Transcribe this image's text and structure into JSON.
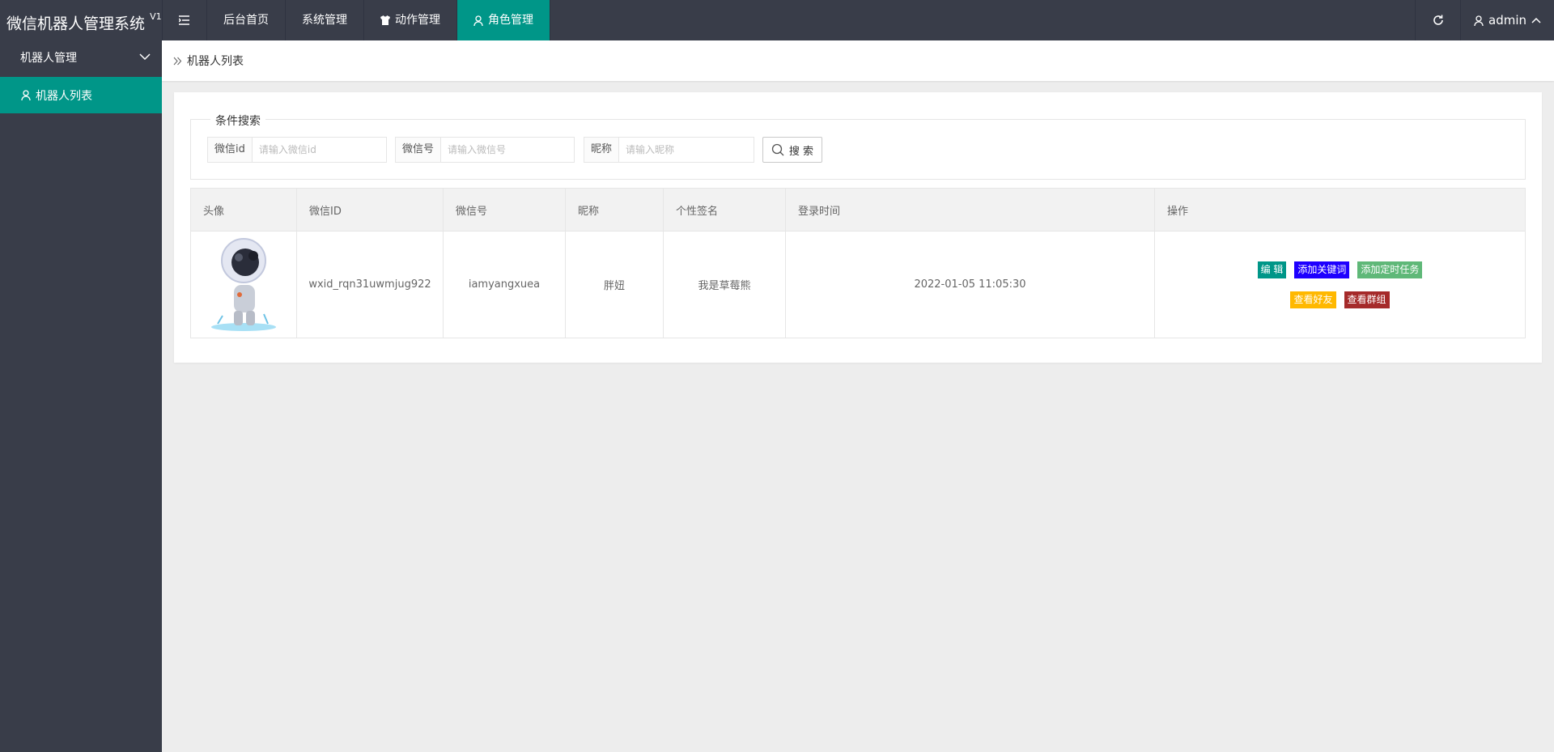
{
  "app": {
    "title": "微信机器人管理系统",
    "version": "V1"
  },
  "header": {
    "nav": [
      {
        "label": "后台首页"
      },
      {
        "label": "系统管理"
      },
      {
        "label": "动作管理"
      },
      {
        "label": "角色管理"
      }
    ],
    "user": "admin"
  },
  "sidebar": {
    "group": "机器人管理",
    "items": [
      {
        "label": "机器人列表"
      }
    ]
  },
  "breadcrumb": "机器人列表",
  "search": {
    "legend": "条件搜索",
    "fields": [
      {
        "label": "微信id",
        "placeholder": "请输入微信id"
      },
      {
        "label": "微信号",
        "placeholder": "请输入微信号"
      },
      {
        "label": "昵称",
        "placeholder": "请输入昵称"
      }
    ],
    "button": "搜 索"
  },
  "table": {
    "columns": [
      "头像",
      "微信ID",
      "微信号",
      "昵称",
      "个性签名",
      "登录时间",
      "操作"
    ],
    "rows": [
      {
        "wxid": "wxid_rqn31uwmjug922",
        "wechat": "iamyangxuea",
        "nickname": "胖妞",
        "signature": "我是草莓熊",
        "login_time": "2022-01-05 11:05:30"
      }
    ],
    "actions": {
      "edit": "编 辑",
      "add_keyword": "添加关键词",
      "add_task": "添加定时任务",
      "view_friends": "查看好友",
      "view_groups": "查看群组"
    }
  },
  "colors": {
    "header_bg": "#393d49",
    "accent": "#009688",
    "btn_edit": "#009688",
    "btn_keyword": "#1e00ff",
    "btn_task": "#5fb878",
    "btn_friends": "#ffb800",
    "btn_groups": "#a52a2a"
  }
}
